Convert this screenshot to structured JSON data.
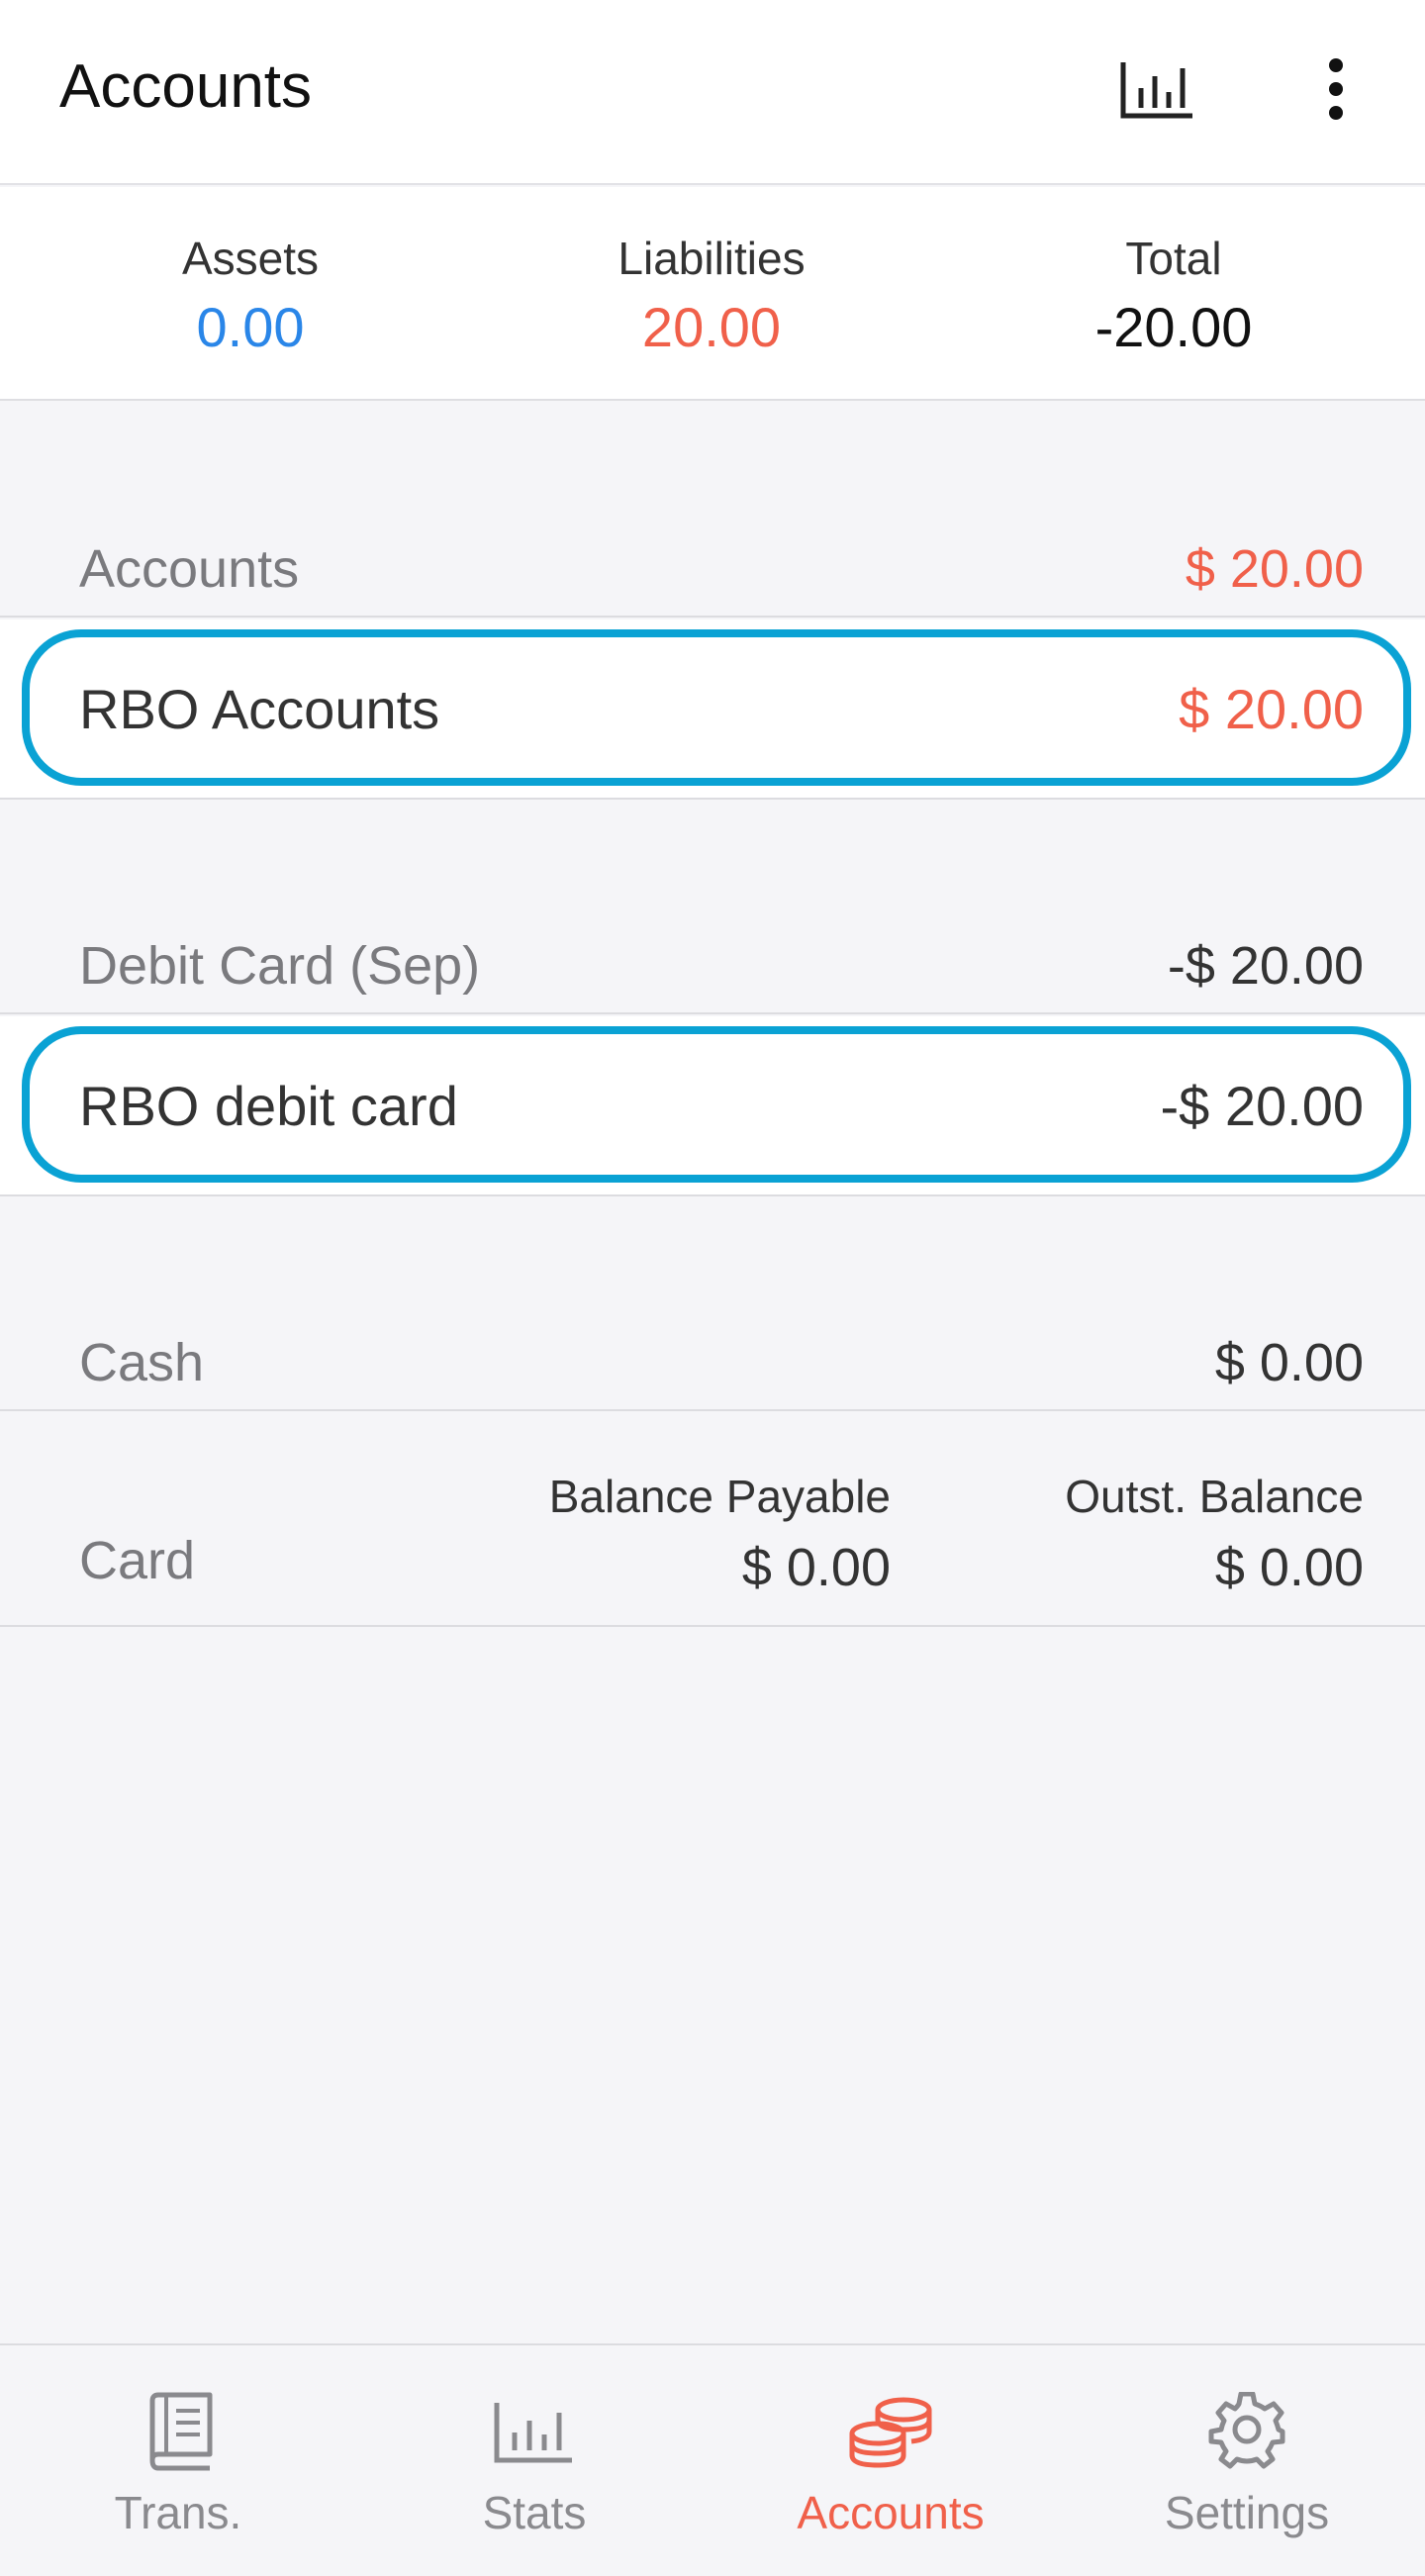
{
  "appbar": {
    "title": "Accounts",
    "stats_icon": "bar-chart-icon",
    "more_icon": "more-vertical-icon"
  },
  "summary": {
    "assets_label": "Assets",
    "assets_value": "0.00",
    "liabilities_label": "Liabilities",
    "liabilities_value": "20.00",
    "total_label": "Total",
    "total_value": "-20.00"
  },
  "groups": {
    "accounts": {
      "label": "Accounts",
      "amount": "$ 20.00",
      "items": [
        {
          "label": "RBO Accounts",
          "amount": "$ 20.00"
        }
      ]
    },
    "debit": {
      "label": "Debit Card (Sep)",
      "amount": "-$ 20.00",
      "items": [
        {
          "label": "RBO debit card",
          "amount": "-$ 20.00"
        }
      ]
    },
    "cash": {
      "label": "Cash",
      "amount": "$ 0.00"
    },
    "card": {
      "label": "Card",
      "balance_payable_label": "Balance Payable",
      "balance_payable_value": "$ 0.00",
      "outstanding_label": "Outst. Balance",
      "outstanding_value": "$ 0.00"
    }
  },
  "nav": {
    "items": [
      {
        "label": "Trans.",
        "icon": "book-icon"
      },
      {
        "label": "Stats",
        "icon": "bar-chart-icon"
      },
      {
        "label": "Accounts",
        "icon": "coins-icon",
        "active": true
      },
      {
        "label": "Settings",
        "icon": "gear-icon"
      }
    ]
  },
  "colors": {
    "asset_blue": "#2a86e8",
    "liability_red": "#f0604a",
    "highlight_blue": "#0aa2d4",
    "text_dark": "#333333",
    "text_muted": "#7a7a7e"
  }
}
